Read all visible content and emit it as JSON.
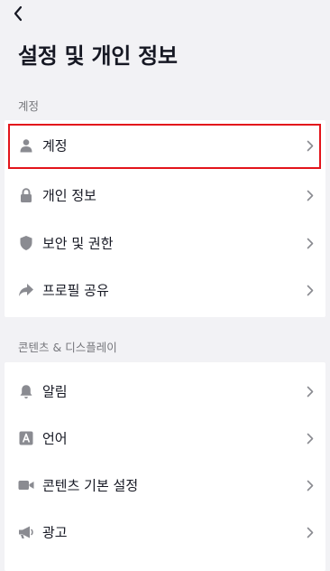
{
  "header": {
    "back_icon": "chevron-left-icon",
    "title": "설정 및 개인 정보"
  },
  "sections": [
    {
      "title": "계정",
      "items": [
        {
          "label": "계정",
          "icon": "person-icon",
          "highlighted": true
        },
        {
          "label": "개인 정보",
          "icon": "lock-icon"
        },
        {
          "label": "보안 및 권한",
          "icon": "shield-icon"
        },
        {
          "label": "프로필 공유",
          "icon": "share-arrow-icon"
        }
      ]
    },
    {
      "title": "콘텐츠 & 디스플레이",
      "items": [
        {
          "label": "알림",
          "icon": "bell-icon"
        },
        {
          "label": "언어",
          "icon": "language-icon"
        },
        {
          "label": "콘텐츠 기본 설정",
          "icon": "video-camera-icon"
        },
        {
          "label": "광고",
          "icon": "megaphone-icon"
        }
      ]
    }
  ],
  "colors": {
    "background": "#f2f2f5",
    "card": "#ffffff",
    "text": "#161823",
    "secondary_text": "#75767b",
    "icon": "#8a8b91",
    "highlight": "#e3141b"
  }
}
